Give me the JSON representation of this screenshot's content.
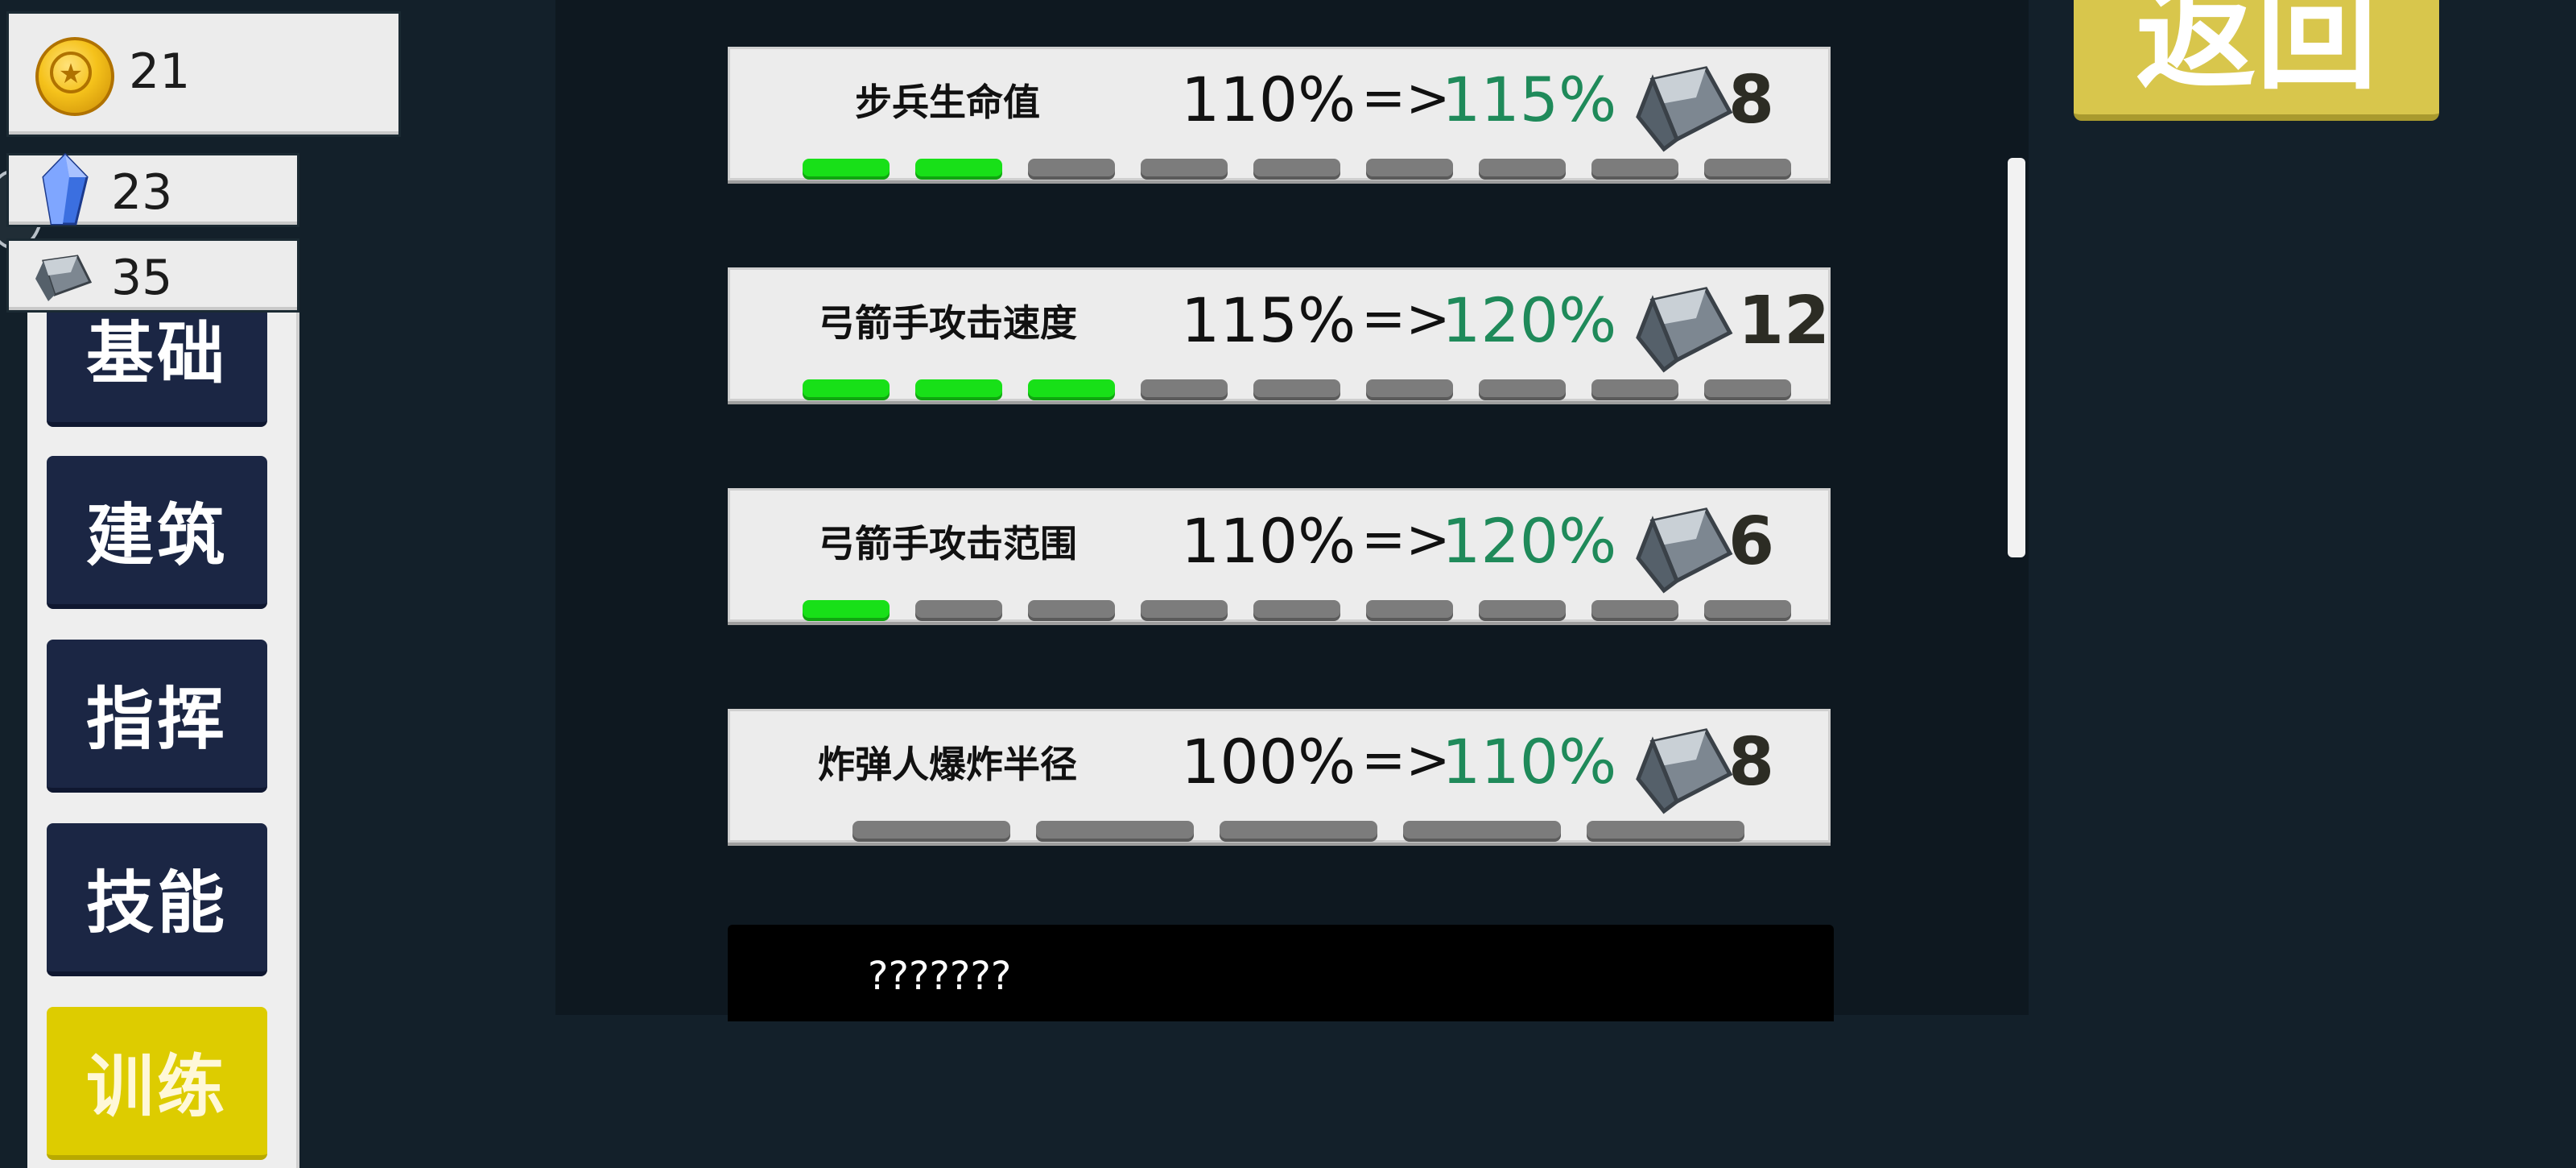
{
  "resources": {
    "gold": "21",
    "crystal": "23",
    "iron": "35"
  },
  "sidebar": {
    "items": [
      {
        "label": "基础"
      },
      {
        "label": "建筑"
      },
      {
        "label": "指挥"
      },
      {
        "label": "技能"
      },
      {
        "label": "训练",
        "active": true
      }
    ]
  },
  "upgrades": [
    {
      "name": "步兵生命值",
      "current": "110%",
      "arrow": "=>",
      "next": "115%",
      "cost": "8",
      "level": 2,
      "max_level": 9
    },
    {
      "name": "弓箭手攻击速度",
      "current": "115%",
      "arrow": "=>",
      "next": "120%",
      "cost": "12",
      "level": 3,
      "max_level": 9
    },
    {
      "name": "弓箭手攻击范围",
      "current": "110%",
      "arrow": "=>",
      "next": "120%",
      "cost": "6",
      "level": 1,
      "max_level": 9
    },
    {
      "name": "炸弹人爆炸半径",
      "current": "100%",
      "arrow": "=>",
      "next": "110%",
      "cost": "8",
      "level": 0,
      "max_level": 5
    }
  ],
  "locked": {
    "name": "???????"
  },
  "back_button": {
    "label": "返回"
  },
  "colors": {
    "background": "#13202a",
    "nav_button": "#1b2644",
    "nav_active": "#ddcc00",
    "next_value": "#1f8a5a",
    "progress_on": "#18e018",
    "progress_off": "#7c7c7c",
    "back_button": "#d8c64c"
  },
  "icons": {
    "gold": "gold-coin-icon",
    "crystal": "blue-crystal-icon",
    "iron": "iron-ingot-icon"
  }
}
